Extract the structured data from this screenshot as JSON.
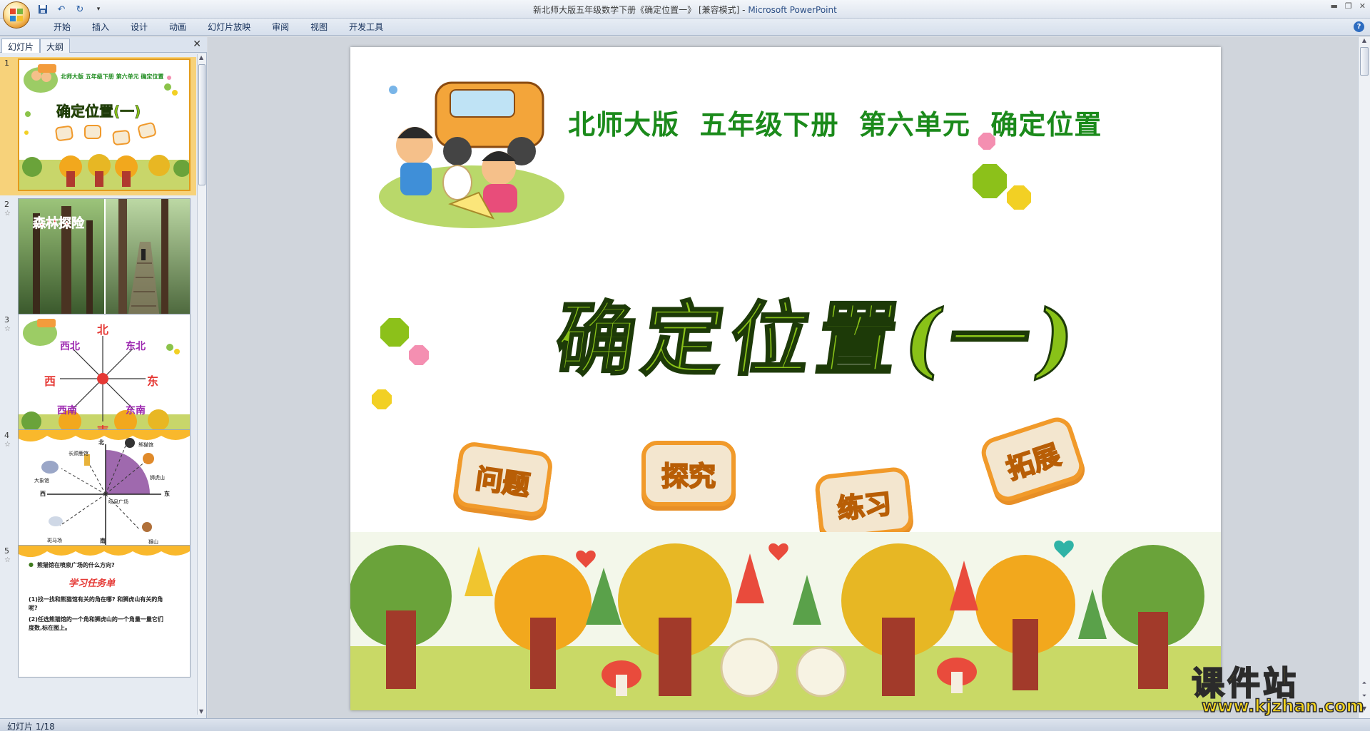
{
  "window": {
    "title_prefix": "新北师大版五年级数学下册《确定位置一》 [兼容模式] - ",
    "app_name": "Microsoft PowerPoint"
  },
  "menu": {
    "items": [
      "开始",
      "插入",
      "设计",
      "动画",
      "幻灯片放映",
      "审阅",
      "视图",
      "开发工具"
    ]
  },
  "pane": {
    "tab_slides": "幻灯片",
    "tab_outline": "大纲",
    "close": "✕"
  },
  "thumbnails": [
    {
      "num": "1",
      "star": "☆"
    },
    {
      "num": "2",
      "star": "☆"
    },
    {
      "num": "3",
      "star": "☆"
    },
    {
      "num": "4",
      "star": "☆"
    },
    {
      "num": "5",
      "star": "☆"
    }
  ],
  "thumb1": {
    "header": "北师大版 五年级下册 第六单元 确定位置",
    "main": "确定位置(一)"
  },
  "thumb2": {
    "title": "森林探险"
  },
  "thumb3": {
    "north": "北",
    "south": "南",
    "east": "东",
    "west": "西",
    "ne": "东北",
    "nw": "西北",
    "se": "东南",
    "sw": "西南"
  },
  "thumb4": {
    "north": "北",
    "south": "南",
    "east": "东",
    "west": "西",
    "labels": [
      "熊猫馆",
      "长颈鹿馆",
      "大象馆",
      "狮虎山",
      "猴山",
      "斑马场",
      "喷泉广场"
    ]
  },
  "thumb5": {
    "question": "熊猫馆在喷泉广场的什么方向?",
    "heading": "学习任务单",
    "line1": "(1)找一找和熊猫馆有关的角在哪? 和狮虎山有关的角呢?",
    "line2": "(2)任选熊猫馆的一个角和狮虎山的一个角量一量它们度数,标在图上。"
  },
  "slide": {
    "title": "北师大版  五年级下册  第六单元  确定位置",
    "main": "确定位置(一)",
    "tags": [
      "问题",
      "探究",
      "练习",
      "拓展"
    ]
  },
  "status": {
    "text": "幻灯片 1/18"
  },
  "watermark": {
    "cn": "课件站",
    "en": "www.kjzhan.com"
  },
  "colors": {
    "title_green": "#1b8a1b",
    "main_green": "#89c218",
    "tag_orange": "#f08a16",
    "accent_gold": "#f4d41f"
  }
}
